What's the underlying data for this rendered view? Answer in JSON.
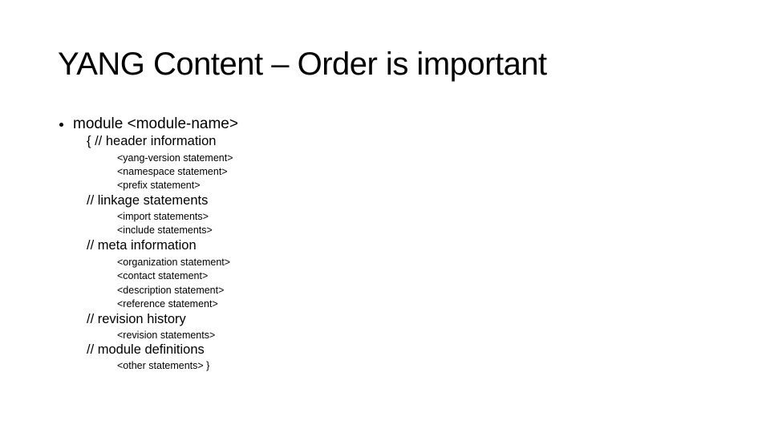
{
  "slide": {
    "title": "YANG Content – Order is important",
    "bullet": "module <module-name>",
    "lines": [
      {
        "level": 2,
        "text": "{ // header information"
      },
      {
        "level": 3,
        "text": "<yang-version statement>"
      },
      {
        "level": 3,
        "text": " <namespace statement>"
      },
      {
        "level": 3,
        "text": " <prefix statement>"
      },
      {
        "level": 2,
        "text": "// linkage statements"
      },
      {
        "level": 3,
        "text": "<import statements>"
      },
      {
        "level": 3,
        "text": "<include statements>"
      },
      {
        "level": 2,
        "text": "// meta information"
      },
      {
        "level": 3,
        "text": "<organization statement>"
      },
      {
        "level": 3,
        "text": "<contact statement>"
      },
      {
        "level": 3,
        "text": "<description statement>"
      },
      {
        "level": 3,
        "text": "<reference statement>"
      },
      {
        "level": 2,
        "text": "// revision history"
      },
      {
        "level": 3,
        "text": "<revision statements>"
      },
      {
        "level": 2,
        "text": "// module definitions"
      },
      {
        "level": 3,
        "text": "<other statements> }"
      }
    ]
  }
}
